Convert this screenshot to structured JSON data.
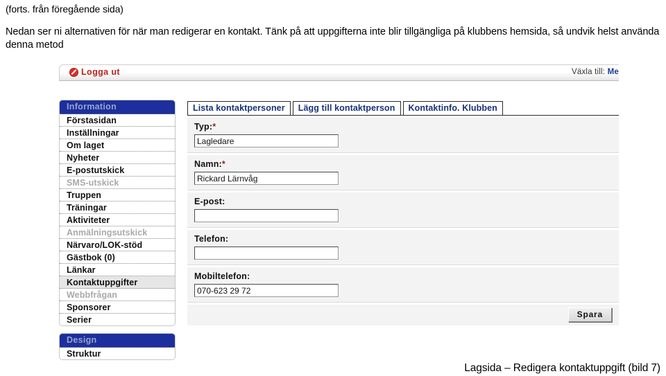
{
  "caption": {
    "continuation": "(forts. från föregående sida)",
    "paragraph": "Nedan ser ni alternativen för när man redigerar en kontakt. Tänk på att uppgifterna inte blir tillgängliga på klubbens hemsida, så undvik helst använda denna metod"
  },
  "topbar": {
    "logout_label": "Logga ut",
    "switch_label": "Växla till:",
    "switch_target": "Me"
  },
  "sidebar": {
    "groups": [
      {
        "header": "Information",
        "items": [
          {
            "label": "Förstasidan",
            "state": "normal"
          },
          {
            "label": "Inställningar",
            "state": "normal"
          },
          {
            "label": "Om laget",
            "state": "normal"
          },
          {
            "label": "Nyheter",
            "state": "normal"
          },
          {
            "label": "E-postutskick",
            "state": "normal"
          },
          {
            "label": "SMS-utskick",
            "state": "disabled"
          },
          {
            "label": "Truppen",
            "state": "normal"
          },
          {
            "label": "Träningar",
            "state": "normal"
          },
          {
            "label": "Aktiviteter",
            "state": "normal"
          },
          {
            "label": "Anmälningsutskick",
            "state": "disabled"
          },
          {
            "label": "Närvaro/LOK-stöd",
            "state": "normal"
          },
          {
            "label": "Gästbok (0)",
            "state": "normal"
          },
          {
            "label": "Länkar",
            "state": "normal"
          },
          {
            "label": "Kontaktuppgifter",
            "state": "current"
          },
          {
            "label": "Webbfrågan",
            "state": "disabled"
          },
          {
            "label": "Sponsorer",
            "state": "normal"
          },
          {
            "label": "Serier",
            "state": "normal"
          }
        ]
      },
      {
        "header": "Design",
        "items": [
          {
            "label": "Struktur",
            "state": "normal"
          }
        ]
      }
    ]
  },
  "content": {
    "tabs": [
      {
        "label": "Lista kontaktpersoner"
      },
      {
        "label": "Lägg till kontaktperson"
      },
      {
        "label": "Kontaktinfo. Klubben"
      }
    ],
    "fields": [
      {
        "label": "Typ:",
        "required": "*",
        "value": "Lagledare",
        "placeholder": ""
      },
      {
        "label": "Namn:",
        "required": "*",
        "value": "Rickard Lärnvåg",
        "placeholder": ""
      },
      {
        "label": "E-post:",
        "required": "",
        "value": "",
        "placeholder": ""
      },
      {
        "label": "Telefon:",
        "required": "",
        "value": "",
        "placeholder": ""
      },
      {
        "label": "Mobiltelefon:",
        "required": "",
        "value": "070-623 29 72",
        "placeholder": ""
      }
    ],
    "save_label": "Spara"
  },
  "footer": {
    "caption": "Lagsida – Redigera kontaktuppgift (bild 7)"
  },
  "colors": {
    "menu_header_blue": "#1c2f9c",
    "tab_text_navy": "#17327c",
    "logout_red": "#c0221b",
    "required_red": "#8a2a22"
  }
}
